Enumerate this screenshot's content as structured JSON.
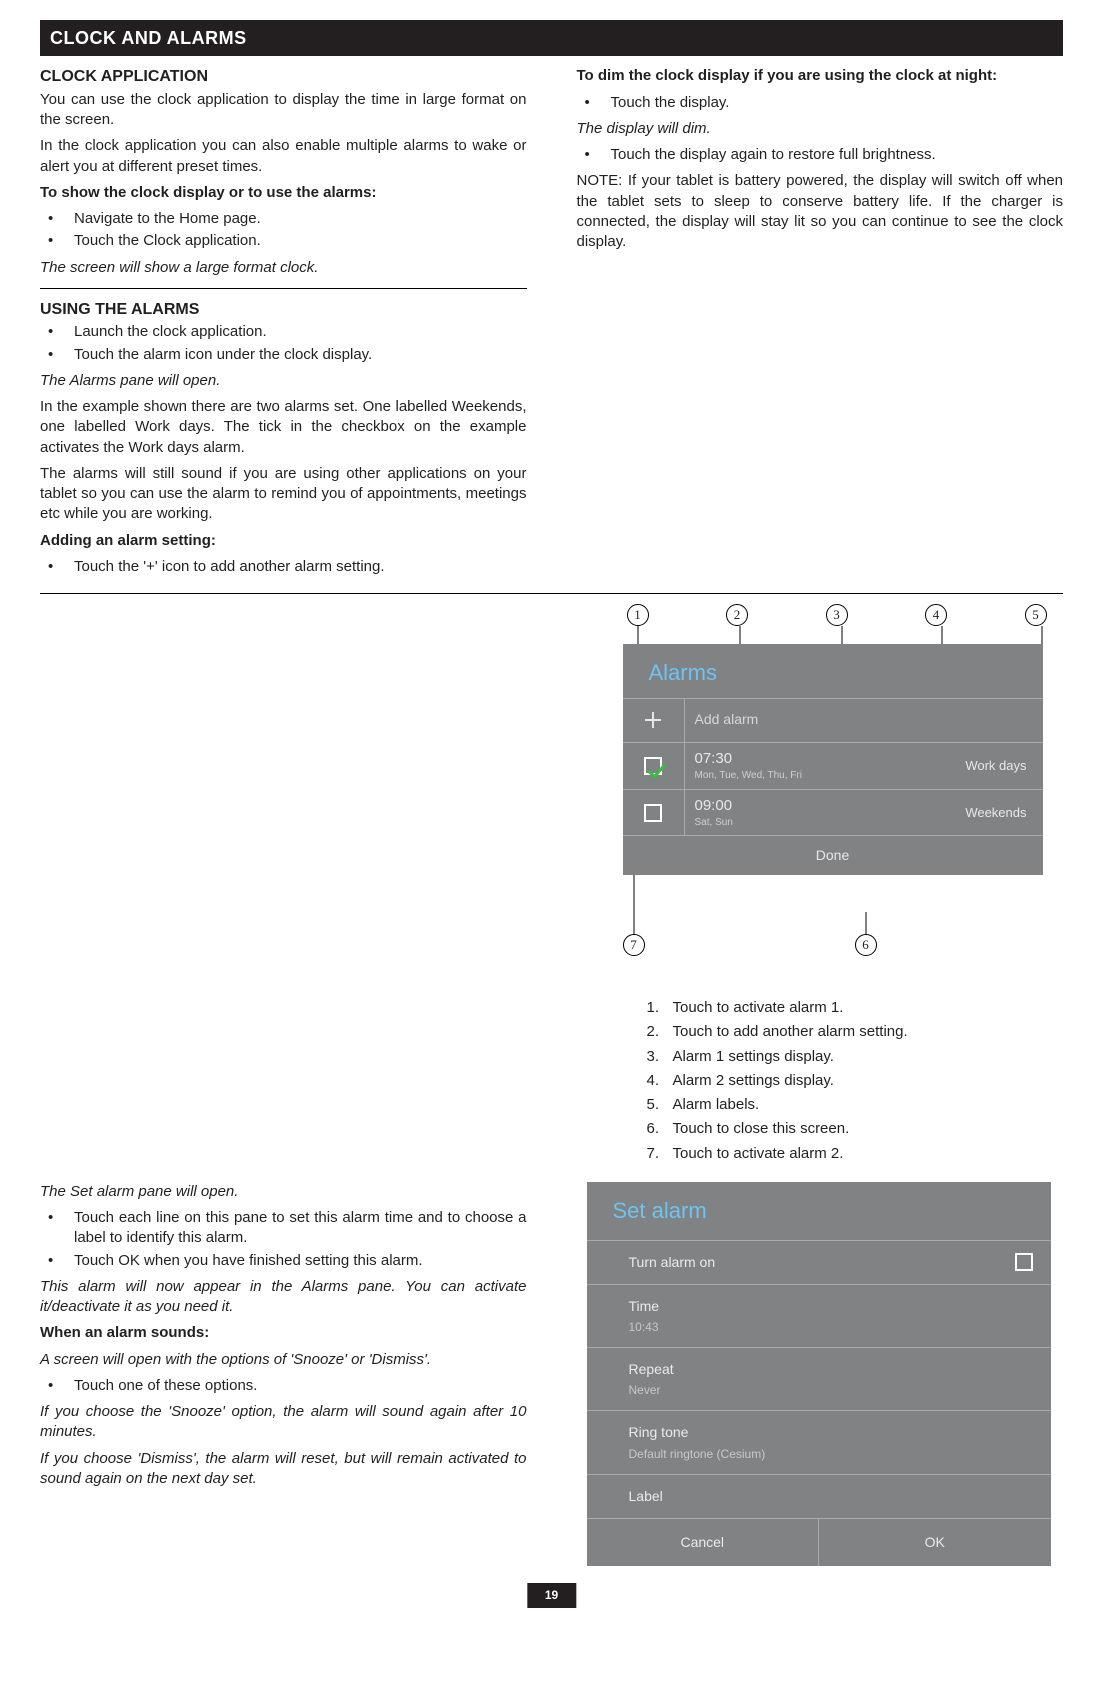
{
  "page_number": "19",
  "title_bar": "CLOCK AND ALARMS",
  "left": {
    "h_clock_app": "CLOCK APPLICATION",
    "p1": "You can use the clock application to display the time in large format on the screen.",
    "p2": "In the clock application you can also enable multiple alarms to wake or alert you at different preset times.",
    "p3_bold": "To show the clock display or to use the alarms:",
    "b1": "Navigate to the Home page.",
    "b2": "Touch the Clock application.",
    "p4_italic": "The screen will show a large format clock.",
    "h_using": "USING THE ALARMS",
    "u1": "Launch the clock application.",
    "u2": "Touch the alarm icon under the clock display.",
    "p5_italic": "The Alarms pane will open.",
    "p6": "In the example shown there are two alarms set. One labelled Weekends, one labelled Work days. The tick in the checkbox on the example activates the Work days alarm.",
    "p7": "The alarms will still sound if you are using other applications on your tablet so you can use the alarm to remind you of appointments, meetings etc while you are working.",
    "p8_bold": "Adding an alarm setting:",
    "b_add": "Touch the '+' icon to add another alarm setting.",
    "p_set_open_italic": "The Set alarm pane will open.",
    "s1": "Touch each line on this pane to set this alarm time and to choose a label to identify this alarm.",
    "s2": "Touch OK when you have finished setting this alarm.",
    "p_appear_italic": "This alarm will now appear in the Alarms pane. You can activate it/deactivate it as you need it.",
    "p_when_bold": "When an alarm sounds:",
    "p_snooze_screen_italic": "A screen will open with the options of 'Snooze' or 'Dismiss'.",
    "b_touch_one": "Touch one of these options.",
    "p_snooze_italic": "If you choose the 'Snooze' option, the alarm will sound again after 10 minutes.",
    "p_dismiss_italic": "If you choose 'Dismiss', the alarm will reset, but will remain activated to sound again on the next day set."
  },
  "right": {
    "p_dim_bold": "To dim the clock display if you are using the clock at night:",
    "b_dim1": "Touch the display.",
    "p_dim_italic": "The display will dim.",
    "b_dim2": "Touch the display again to restore full brightness.",
    "p_note": "NOTE: If your tablet is battery powered, the display will switch off when the tablet sets to sleep to conserve battery life. If the charger is connected, the display will stay lit so you can continue to see the clock display."
  },
  "alarms_panel": {
    "title": "Alarms",
    "add_alarm": "Add alarm",
    "alarm1_time": "07:30",
    "alarm1_days": "Mon, Tue, Wed, Thu, Fri",
    "alarm1_label": "Work days",
    "alarm2_time": "09:00",
    "alarm2_days": "Sat, Sun",
    "alarm2_label": "Weekends",
    "done": "Done",
    "callouts": {
      "c1": "1",
      "c2": "2",
      "c3": "3",
      "c4": "4",
      "c5": "5",
      "c6": "6",
      "c7": "7"
    }
  },
  "legend": {
    "l1n": "1.",
    "l1": "Touch to activate alarm 1.",
    "l2n": "2.",
    "l2": "Touch to add another alarm setting.",
    "l3n": "3.",
    "l3": "Alarm 1 settings display.",
    "l4n": "4.",
    "l4": "Alarm 2 settings display.",
    "l5n": "5.",
    "l5": "Alarm labels.",
    "l6n": "6.",
    "l6": "Touch to close this screen.",
    "l7n": "7.",
    "l7": "Touch to activate alarm 2."
  },
  "set_alarm": {
    "title": "Set alarm",
    "turn_on": "Turn alarm on",
    "time_label": "Time",
    "time_value": "10:43",
    "repeat_label": "Repeat",
    "repeat_value": "Never",
    "ring_label": "Ring tone",
    "ring_value": "Default ringtone (Cesium)",
    "label_label": "Label",
    "cancel": "Cancel",
    "ok": "OK"
  }
}
